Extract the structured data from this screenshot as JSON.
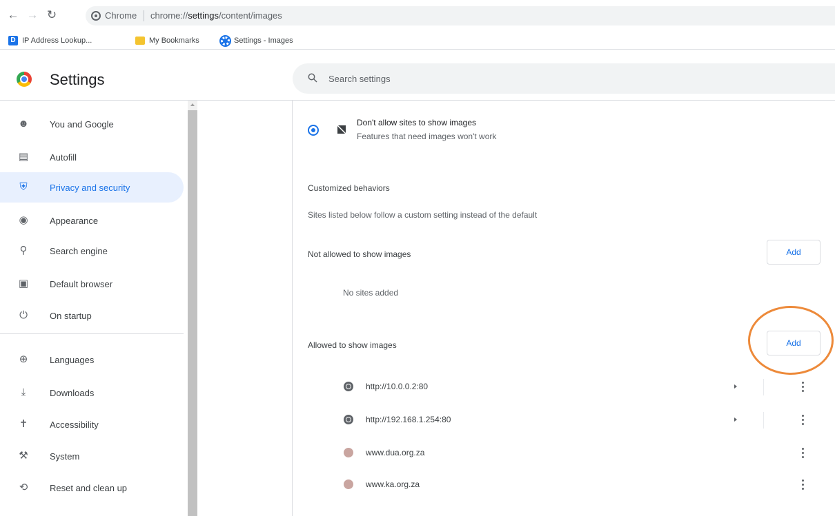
{
  "browser": {
    "back_icon": "arrow-left-icon",
    "forward_icon": "arrow-right-icon",
    "reload_icon": "reload-icon",
    "site_label": "Chrome",
    "url_prefix": "chrome://",
    "url_host": "settings",
    "url_path": "/content/images"
  },
  "bookmarks": [
    {
      "label": "IP Address Lookup...",
      "icon": "site-favicon-icon"
    },
    {
      "label": "My Bookmarks",
      "icon": "folder-icon"
    },
    {
      "label": "Settings - Images",
      "icon": "gear-icon"
    }
  ],
  "header": {
    "title": "Settings",
    "search_placeholder": "Search settings"
  },
  "sidebar": {
    "items": [
      {
        "label": "You and Google",
        "icon": "person-icon"
      },
      {
        "label": "Autofill",
        "icon": "clipboard-icon"
      },
      {
        "label": "Privacy and security",
        "icon": "shield-icon",
        "active": true
      },
      {
        "label": "Appearance",
        "icon": "palette-icon"
      },
      {
        "label": "Search engine",
        "icon": "search-icon"
      },
      {
        "label": "Default browser",
        "icon": "browser-icon"
      },
      {
        "label": "On startup",
        "icon": "power-icon"
      },
      {
        "label": "Languages",
        "icon": "globe-icon"
      },
      {
        "label": "Downloads",
        "icon": "download-icon"
      },
      {
        "label": "Accessibility",
        "icon": "accessibility-icon"
      },
      {
        "label": "System",
        "icon": "wrench-icon"
      },
      {
        "label": "Reset and clean up",
        "icon": "restore-icon"
      }
    ]
  },
  "main": {
    "block_option": {
      "title": "Don't allow sites to show images",
      "subtitle": "Features that need images won't work",
      "selected": true
    },
    "customized": {
      "title": "Customized behaviors",
      "description": "Sites listed below follow a custom setting instead of the default"
    },
    "not_allowed": {
      "title": "Not allowed to show images",
      "add_label": "Add",
      "empty_text": "No sites added"
    },
    "allowed": {
      "title": "Allowed to show images",
      "add_label": "Add",
      "sites": [
        {
          "url": "http://10.0.0.2:80",
          "icon": "globe-icon",
          "has_arrow": true
        },
        {
          "url": "http://192.168.1.254:80",
          "icon": "globe-icon",
          "has_arrow": true
        },
        {
          "url": "www.dua.org.za",
          "icon": "site-favicon-icon",
          "has_arrow": false
        },
        {
          "url": "www.ka.org.za",
          "icon": "site-favicon-icon",
          "has_arrow": false
        }
      ]
    }
  },
  "colors": {
    "accent": "#1a73e8",
    "active_nav_bg": "#e8f0fe",
    "highlight_ring": "#ed8a3a"
  }
}
